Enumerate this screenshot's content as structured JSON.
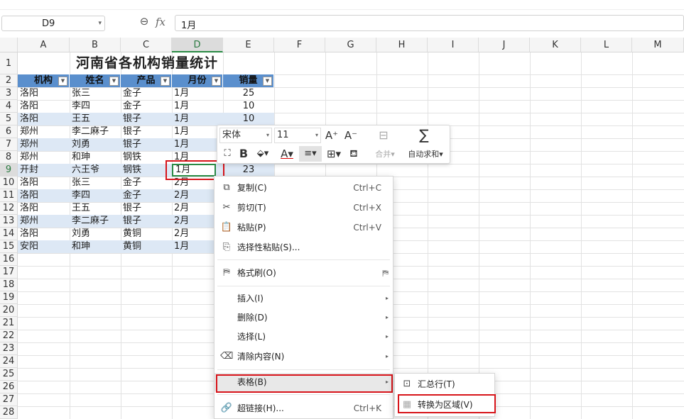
{
  "formula_bar": {
    "cell_ref": "D9",
    "value": "1月"
  },
  "columns": [
    "A",
    "B",
    "C",
    "D",
    "E",
    "F",
    "G",
    "H",
    "I",
    "J",
    "K",
    "L",
    "M"
  ],
  "rows": [
    "1",
    "2",
    "3",
    "4",
    "5",
    "6",
    "7",
    "8",
    "9",
    "10",
    "11",
    "12",
    "13",
    "14",
    "15",
    "16",
    "17",
    "18",
    "19",
    "20",
    "21",
    "22",
    "23",
    "24",
    "25",
    "26",
    "27",
    "28"
  ],
  "sheet": {
    "title": "河南省各机构销量统计",
    "headers": [
      "机构",
      "姓名",
      "产品",
      "月份",
      "销量"
    ],
    "data": [
      [
        "洛阳",
        "张三",
        "金子",
        "1月",
        "25"
      ],
      [
        "洛阳",
        "李四",
        "金子",
        "1月",
        "10"
      ],
      [
        "洛阳",
        "王五",
        "银子",
        "1月",
        "10"
      ],
      [
        "郑州",
        "李二麻子",
        "银子",
        "1月",
        ""
      ],
      [
        "郑州",
        "刘勇",
        "银子",
        "1月",
        ""
      ],
      [
        "郑州",
        "和珅",
        "钢铁",
        "1月",
        ""
      ],
      [
        "开封",
        "六王爷",
        "钢铁",
        "1月",
        "23"
      ],
      [
        "洛阳",
        "张三",
        "金子",
        "2月",
        ""
      ],
      [
        "洛阳",
        "李四",
        "金子",
        "2月",
        ""
      ],
      [
        "洛阳",
        "王五",
        "银子",
        "2月",
        ""
      ],
      [
        "郑州",
        "李二麻子",
        "银子",
        "2月",
        ""
      ],
      [
        "洛阳",
        "刘勇",
        "黄铜",
        "2月",
        ""
      ],
      [
        "安阳",
        "和珅",
        "黄铜",
        "1月",
        ""
      ]
    ]
  },
  "mini_toolbar": {
    "font_name": "宋体",
    "font_size": "11",
    "merge_label": "合并",
    "autosum_label": "自动求和"
  },
  "context_menu": {
    "items": [
      {
        "label": "复制(C)",
        "shortcut": "Ctrl+C"
      },
      {
        "label": "剪切(T)",
        "shortcut": "Ctrl+X"
      },
      {
        "label": "粘贴(P)",
        "shortcut": "Ctrl+V"
      },
      {
        "label": "选择性粘贴(S)..."
      },
      {
        "label": "格式刷(O)"
      },
      {
        "label": "插入(I)"
      },
      {
        "label": "删除(D)"
      },
      {
        "label": "选择(L)"
      },
      {
        "label": "清除内容(N)"
      },
      {
        "label": "表格(B)"
      },
      {
        "label": "超链接(H)...",
        "shortcut": "Ctrl+K"
      }
    ]
  },
  "submenu": {
    "items": [
      {
        "label": "汇总行(T)"
      },
      {
        "label": "转换为区域(V)"
      }
    ]
  }
}
